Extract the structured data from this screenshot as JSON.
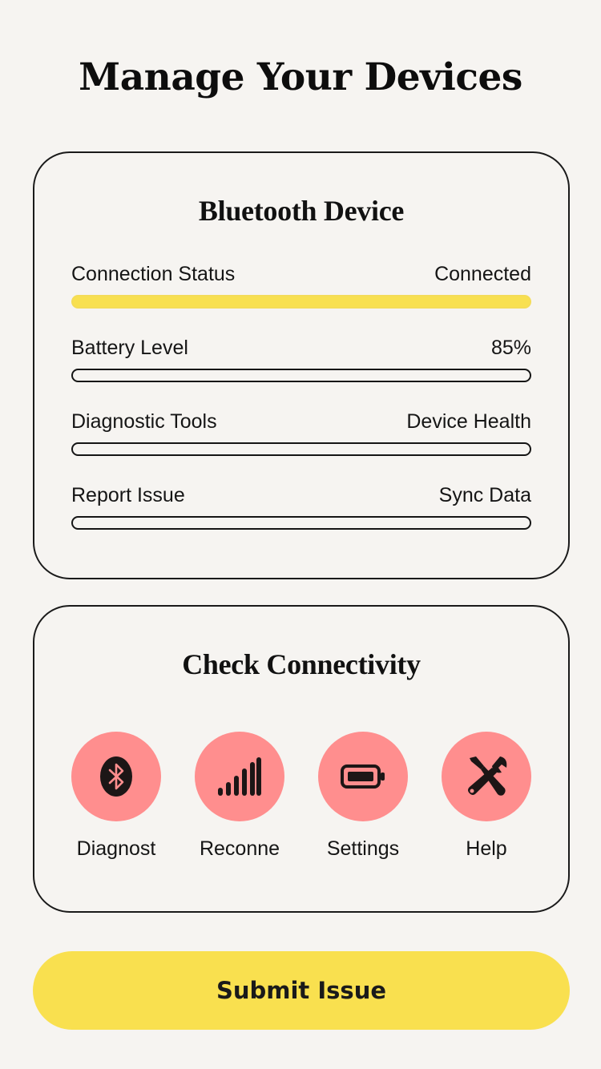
{
  "header": {
    "title": "Manage Your Devices"
  },
  "device_card": {
    "title": "Bluetooth Device",
    "rows": [
      {
        "label": "Connection Status",
        "value": "Connected",
        "progress": 1.0,
        "fill_color": "#f8e050"
      },
      {
        "label": "Battery Level",
        "value": "85%",
        "progress": 0.0,
        "fill_color": "#f8e050"
      },
      {
        "label": "Diagnostic Tools",
        "value": "Device Health",
        "progress": 0.0,
        "fill_color": "#f8e050"
      },
      {
        "label": "Report Issue",
        "value": "Sync Data",
        "progress": 0.0,
        "fill_color": "#f8e050"
      }
    ]
  },
  "connect_card": {
    "title": "Check Connectivity",
    "actions": [
      {
        "label": "Diagnost",
        "icon": "bluetooth-icon"
      },
      {
        "label": "Reconne",
        "icon": "signal-bars-icon"
      },
      {
        "label": "Settings",
        "icon": "battery-icon"
      },
      {
        "label": "Help",
        "icon": "tools-icon"
      }
    ]
  },
  "footer": {
    "submit_label": "Submit Issue"
  },
  "colors": {
    "background": "#f6f4f1",
    "accent_yellow": "#f9e04f",
    "icon_circle": "#ff8e8e",
    "ink": "#141414"
  }
}
